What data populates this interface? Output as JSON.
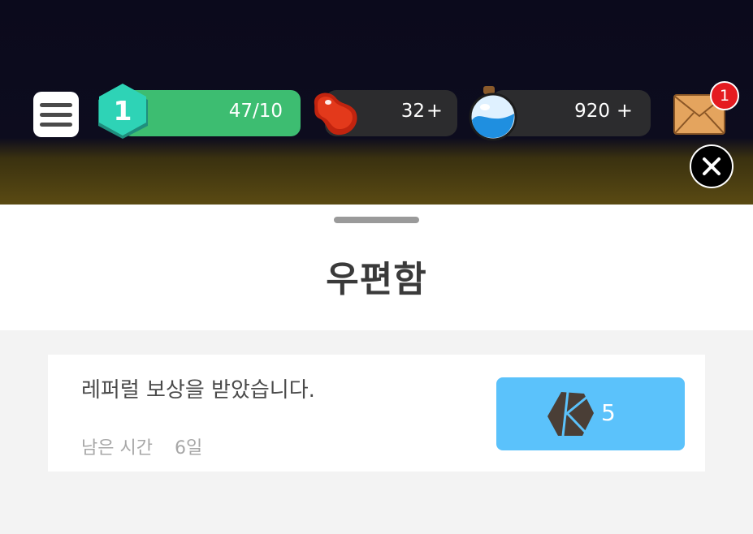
{
  "hud": {
    "level": "1",
    "xp_text": "47/10",
    "beans": {
      "value": "32",
      "plus": "+"
    },
    "potion": {
      "value": "920",
      "plus": "+"
    },
    "mail_badge": "1",
    "icons": {
      "menu": "hamburger-menu-icon",
      "level": "level-hexagon-icon",
      "beans": "red-bean-icon",
      "potion": "potion-bottle-icon",
      "mail": "envelope-icon",
      "close": "close-icon"
    }
  },
  "mailbox": {
    "title": "우편함",
    "items": [
      {
        "message": "레퍼럴 보상을 받았습니다.",
        "time_label": "남은 시간",
        "time_value": "6일",
        "reward_amount": "5",
        "reward_icon": "k-coin-icon"
      }
    ]
  },
  "colors": {
    "level_bar": "#3dbd71",
    "claim_button": "#5bc2fb",
    "badge": "#e51b20"
  }
}
